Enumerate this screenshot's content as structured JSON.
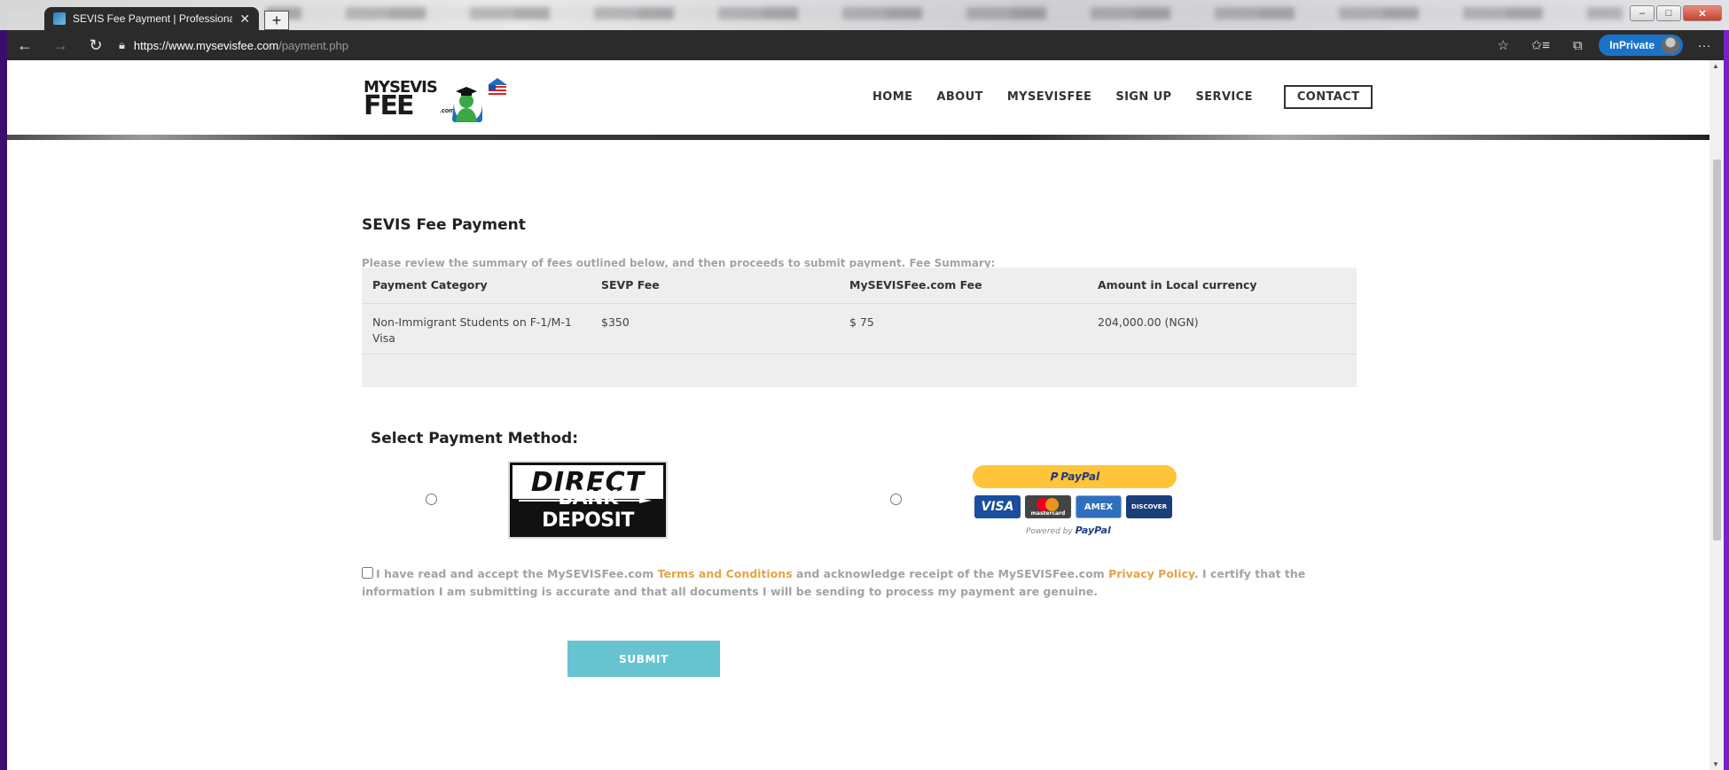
{
  "browser": {
    "tab_title": "SEVIS Fee Payment | Professiona",
    "url_host": "https://www.mysevisfee.com",
    "url_path": "/payment.php",
    "inprivate_label": "InPrivate",
    "icons": [
      "back-icon",
      "forward-icon",
      "refresh-icon",
      "lock-icon",
      "favorites-add-icon",
      "favorites-icon",
      "collections-icon",
      "more-icon"
    ]
  },
  "site": {
    "logo_line1": "MYSEVIS",
    "logo_line2": "FEE",
    "logo_com": ".com",
    "nav": [
      "HOME",
      "ABOUT",
      "MYSEVISFEE",
      "SIGN UP",
      "SERVICE"
    ],
    "nav_contact": "CONTACT",
    "active_nav": "HOME"
  },
  "payment": {
    "title": "SEVIS Fee Payment",
    "intro": "Please review the summary of fees outlined below, and then proceeds to submit payment. Fee Summary:",
    "table": {
      "headers": [
        "Payment Category",
        "SEVP Fee",
        "MySEVISFee.com Fee",
        "Amount in Local currency"
      ],
      "rows": [
        [
          "Non-Immigrant Students on F-1/M-1 Visa",
          "$350",
          "$ 75",
          "204,000.00 (NGN)"
        ]
      ]
    },
    "method_title": "Select Payment Method:",
    "bank": {
      "top": "DIRECT",
      "bottom": "BANK DEPOSIT"
    },
    "paypal": {
      "button": "PayPal",
      "cards": [
        "VISA",
        "mastercard",
        "AMEX",
        "DISCOVER"
      ],
      "powered_prefix": "Powered by",
      "powered_brand": "PayPal"
    },
    "terms": {
      "part1": "I have read and accept the MySEVISFee.com ",
      "link1": "Terms and Conditions",
      "part2": " and acknowledge receipt of the MySEVISFee.com ",
      "link2": "Privacy Policy",
      "part3": ". I certify that the information I am submitting is accurate and that all documents I will be sending to process my payment are genuine."
    },
    "submit_label": "SUBMIT"
  },
  "colors": {
    "accent_submit": "#68c3d1",
    "link": "#e3a44a",
    "paypal_yellow": "#ffc439",
    "inprivate_blue": "#1a73c9"
  }
}
